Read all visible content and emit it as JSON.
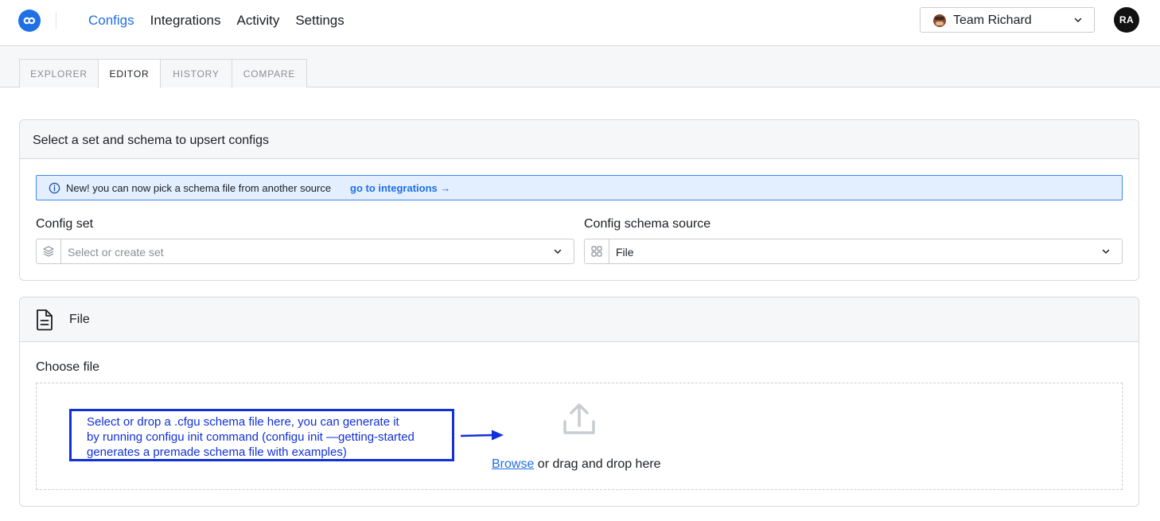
{
  "nav": {
    "items": [
      {
        "label": "Configs",
        "active": true
      },
      {
        "label": "Integrations",
        "active": false
      },
      {
        "label": "Activity",
        "active": false
      },
      {
        "label": "Settings",
        "active": false
      }
    ],
    "team": "Team Richard",
    "user_initials": "RA"
  },
  "tabs": [
    {
      "label": "EXPLORER",
      "active": false
    },
    {
      "label": "EDITOR",
      "active": true
    },
    {
      "label": "HISTORY",
      "active": false
    },
    {
      "label": "COMPARE",
      "active": false
    }
  ],
  "select_card": {
    "title": "Select a set and schema to upsert configs",
    "banner_text": "New! you can now pick a schema file from another source",
    "banner_link": "go to integrations →",
    "config_set_label": "Config set",
    "config_set_placeholder": "Select or create set",
    "schema_source_label": "Config schema source",
    "schema_source_value": "File"
  },
  "file_card": {
    "title": "File",
    "choose_label": "Choose file",
    "browse_link": "Browse",
    "browse_suffix": " or drag and drop here"
  },
  "annotation": {
    "lines": [
      "Select or drop a .cfgu schema file here, you can generate it",
      "by running configu init command (configu init —getting-started",
      "generates a premade schema file with examples)"
    ]
  },
  "colors": {
    "accent": "#1f6fe5",
    "annotation": "#1130d8",
    "banner_bg": "#e3efff"
  }
}
